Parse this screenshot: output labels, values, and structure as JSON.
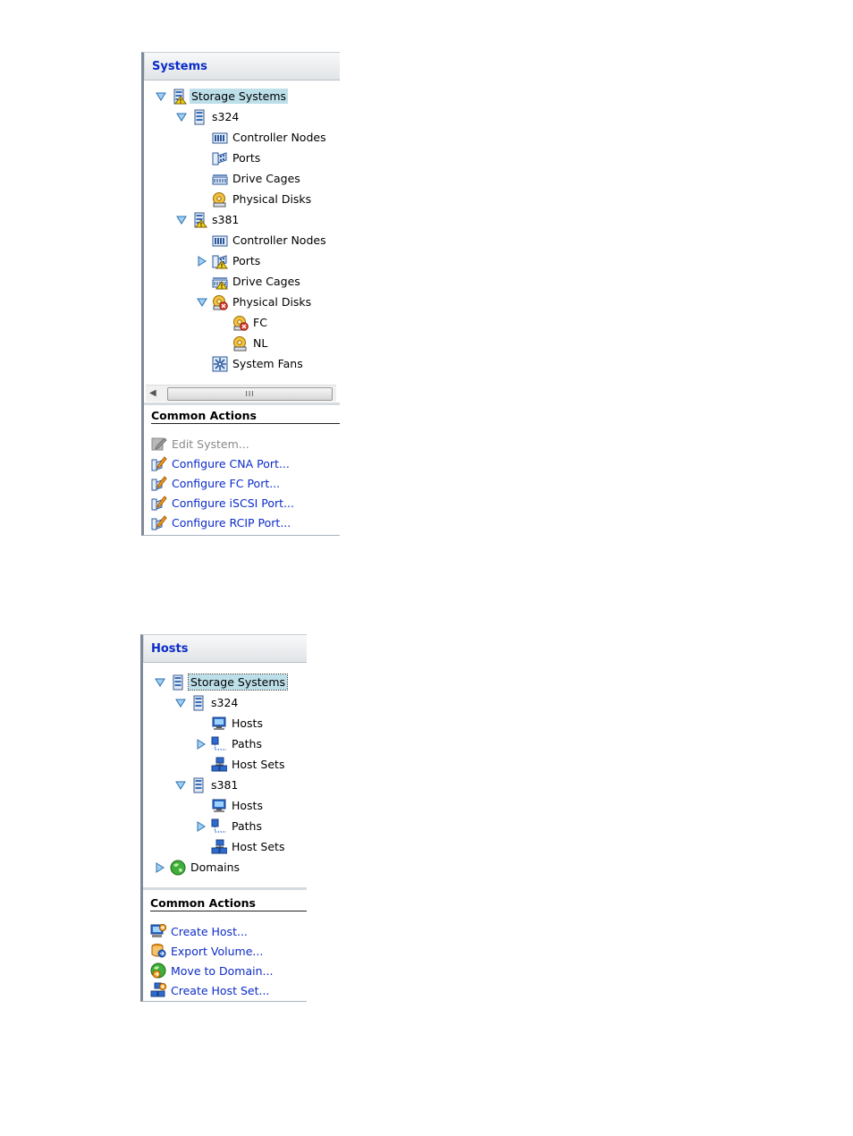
{
  "systems_panel": {
    "title": "Systems",
    "tree": {
      "root": "Storage Systems",
      "s324": {
        "label": "s324",
        "children": [
          "Controller Nodes",
          "Ports",
          "Drive Cages",
          "Physical Disks"
        ]
      },
      "s381": {
        "label": "s381",
        "controller_nodes": "Controller Nodes",
        "ports": "Ports",
        "drive_cages": "Drive Cages",
        "physical_disks": "Physical Disks",
        "disk_types": [
          "FC",
          "NL"
        ],
        "system_fans": "System Fans"
      }
    },
    "scrollbar_grip": "III",
    "common_actions": {
      "title": "Common Actions",
      "items": [
        "Edit System...",
        "Configure CNA Port...",
        "Configure FC Port...",
        "Configure iSCSI Port...",
        "Configure RCIP Port..."
      ]
    }
  },
  "hosts_panel": {
    "title": "Hosts",
    "tree": {
      "root": "Storage Systems",
      "s324": {
        "label": "s324",
        "children": [
          "Hosts",
          "Paths",
          "Host Sets"
        ]
      },
      "s381": {
        "label": "s381",
        "children": [
          "Hosts",
          "Paths",
          "Host Sets"
        ]
      },
      "domains": "Domains"
    },
    "common_actions": {
      "title": "Common Actions",
      "items": [
        "Create Host...",
        "Export Volume...",
        "Move to Domain...",
        "Create Host Set..."
      ]
    }
  },
  "colors": {
    "link": "#0b2bc8",
    "selection": "#bcdfe9",
    "header_gradient_top": "#f7f8f9",
    "header_gradient_bottom": "#e1e4e7"
  }
}
